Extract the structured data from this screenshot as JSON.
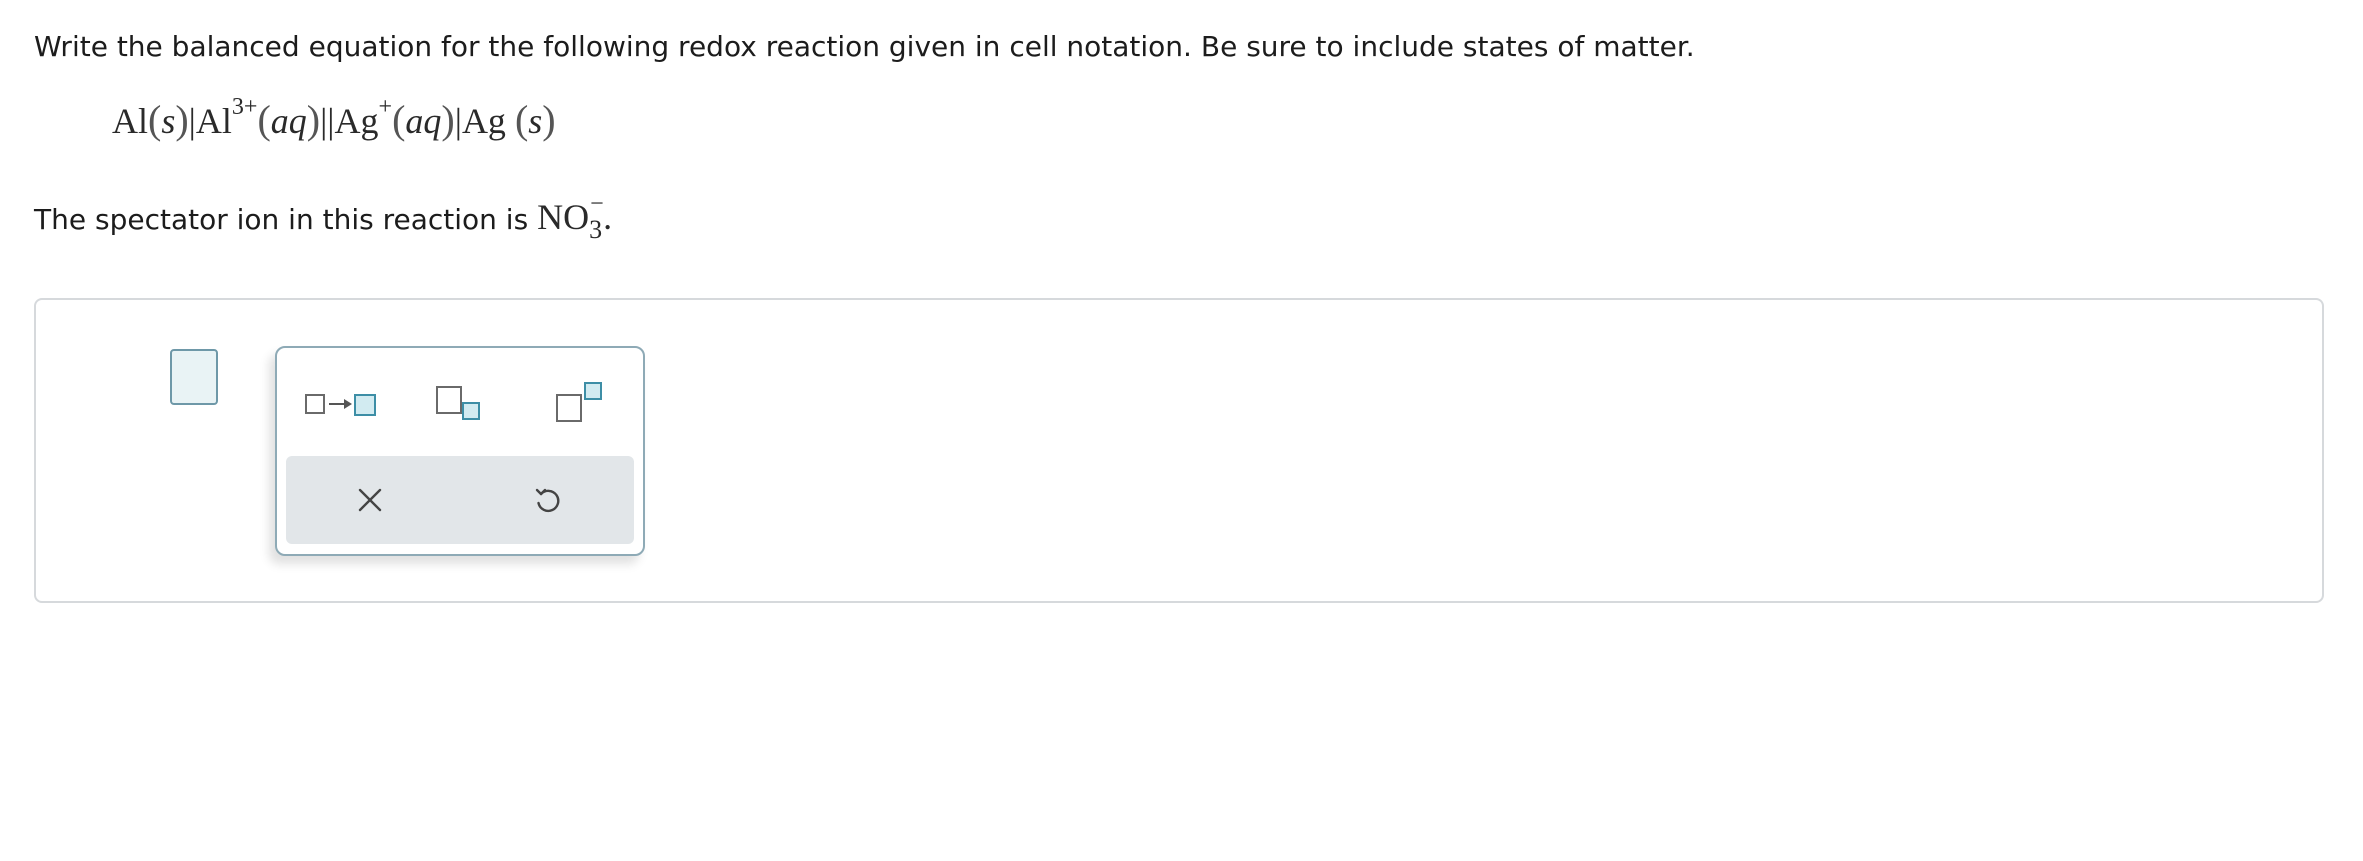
{
  "question": {
    "prompt": "Write the balanced equation for the following redox reaction given in cell notation. Be sure to include states of matter.",
    "cell_notation": {
      "anode_metal": "Al",
      "anode_state": "s",
      "anode_ion": "Al",
      "anode_ion_charge": "3+",
      "anode_ion_state": "aq",
      "salt_bridge": "||",
      "cathode_ion": "Ag",
      "cathode_ion_charge": "+",
      "cathode_ion_state": "aq",
      "cathode_metal": "Ag",
      "cathode_state": "s"
    },
    "spectator_text": "The spectator ion in this reaction is",
    "spectator_formula": "NO",
    "spectator_subscript": "3",
    "spectator_charge": "−",
    "spectator_period": "."
  },
  "answer": {
    "value": ""
  },
  "palette": {
    "tools": [
      {
        "name": "reaction-arrow-tool",
        "icon": "reaction-arrow-template-icon"
      },
      {
        "name": "subscript-tool",
        "icon": "subscript-template-icon"
      },
      {
        "name": "superscript-tool",
        "icon": "superscript-template-icon"
      }
    ],
    "actions": [
      {
        "name": "clear-button",
        "icon": "close-icon"
      },
      {
        "name": "undo-button",
        "icon": "undo-icon"
      }
    ],
    "colors": {
      "accent_border": "#3d8ea6",
      "accent_fill": "#d2ebf1",
      "action_bar": "#e2e6e9"
    }
  }
}
